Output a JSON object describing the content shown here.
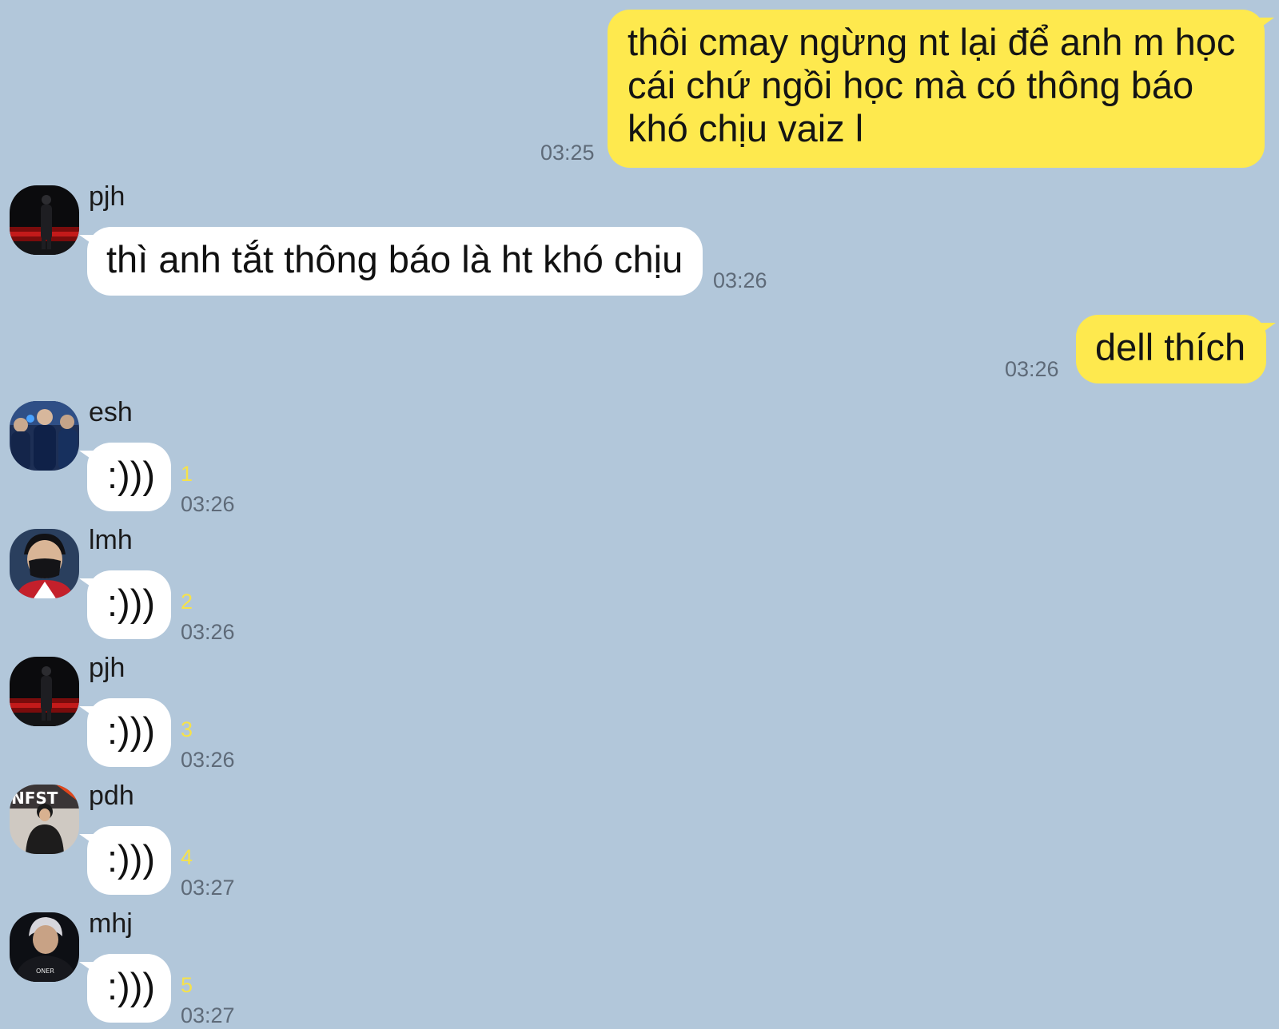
{
  "colors": {
    "background": "#b2c7da",
    "outgoing_bubble": "#fee94e",
    "incoming_bubble": "#ffffff",
    "timestamp": "#5e6a78",
    "unread_count": "#f6e24a"
  },
  "messages": [
    {
      "direction": "outgoing",
      "lines": [
        "thôi cmay ngừng nt lại để anh m học",
        "cái chứ ngồi học mà có thông báo",
        "khó chịu vaiz l"
      ],
      "time": "03:25"
    },
    {
      "direction": "incoming",
      "sender": "pjh",
      "avatar_icon": "profile-photo-avatar",
      "text": "thì anh tắt thông báo là ht khó chịu",
      "time": "03:26"
    },
    {
      "direction": "outgoing",
      "text": "dell thích",
      "time": "03:26"
    },
    {
      "direction": "incoming",
      "sender": "esh",
      "avatar_icon": "profile-photo-avatar",
      "text": ":)))",
      "unread": "1",
      "time": "03:26"
    },
    {
      "direction": "incoming",
      "sender": "lmh",
      "avatar_icon": "profile-photo-avatar",
      "text": ":)))",
      "unread": "2",
      "time": "03:26"
    },
    {
      "direction": "incoming",
      "sender": "pjh",
      "avatar_icon": "profile-photo-avatar",
      "text": ":)))",
      "unread": "3",
      "time": "03:26"
    },
    {
      "direction": "incoming",
      "sender": "pdh",
      "avatar_icon": "profile-photo-avatar",
      "text": ":)))",
      "unread": "4",
      "time": "03:27"
    },
    {
      "direction": "incoming",
      "sender": "mhj",
      "avatar_icon": "profile-photo-avatar",
      "text": ":)))",
      "unread": "5",
      "time": "03:27"
    }
  ]
}
